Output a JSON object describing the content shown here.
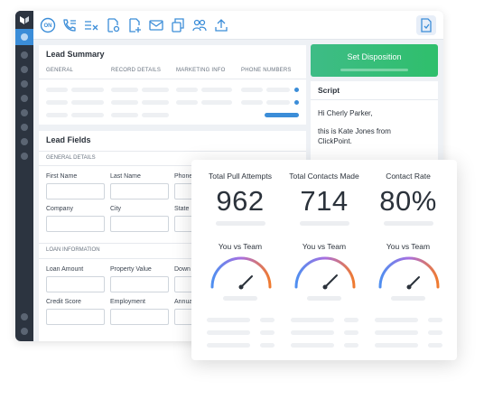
{
  "lead_summary": {
    "title": "Lead Summary",
    "tabs": [
      "GENERAL",
      "RECORD DETAILS",
      "MARKETING INFO",
      "PHONE NUMBERS"
    ]
  },
  "disposition": {
    "button_label": "Set Disposition"
  },
  "script": {
    "title": "Script",
    "greeting": "Hi Cherly Parker,",
    "line1": "this is Kate Jones from",
    "line2": "ClickPoint."
  },
  "lead_fields": {
    "title": "Lead Fields",
    "general_section": "GENERAL DETAILS",
    "loan_section": "LOAN INFORMATION",
    "labels": {
      "first_name": "First Name",
      "last_name": "Last Name",
      "phone": "Phone",
      "company": "Company",
      "city": "City",
      "state": "State",
      "loan_amount": "Loan Amount",
      "property_value": "Property Value",
      "down": "Down",
      "credit_score": "Credit Score",
      "employment": "Employment",
      "annual": "Annua"
    }
  },
  "stats": {
    "items": [
      {
        "label": "Total Pull Attempts",
        "value": "962"
      },
      {
        "label": "Total Contacts Made",
        "value": "714"
      },
      {
        "label": "Contact Rate",
        "value": "80%"
      }
    ],
    "vs_label": "You vs Team"
  },
  "colors": {
    "accent": "#3b8dd8",
    "sidebar": "#2c3440",
    "disposition": "#3ebc86",
    "gauge_start": "#4f8ff0",
    "gauge_mid": "#a86fe0",
    "gauge_end": "#f07a2e"
  },
  "icons": [
    "on-icon",
    "phone-list-icon",
    "checklist-icon",
    "document-settings-icon",
    "document-add-icon",
    "mail-icon",
    "copy-icon",
    "users-icon",
    "upload-icon",
    "document-icon"
  ]
}
